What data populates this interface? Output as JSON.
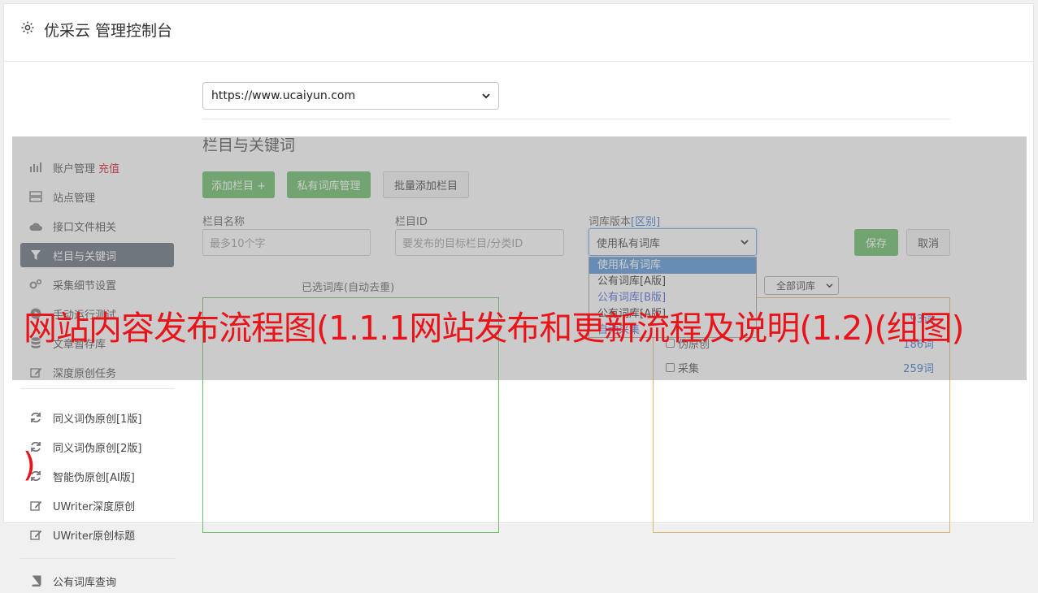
{
  "header": {
    "title": "优采云 管理控制台",
    "icon": "gear-icon"
  },
  "sidebar": {
    "items": [
      {
        "label": "账户管理",
        "badge": "充值",
        "icon": "bar-chart-icon"
      },
      {
        "label": "站点管理",
        "icon": "server-icon"
      },
      {
        "label": "接口文件相关",
        "icon": "cloud-upload-icon"
      },
      {
        "label": "栏目与关键词",
        "icon": "filter-icon",
        "active": true
      },
      {
        "label": "采集细节设置",
        "icon": "cogs-icon"
      },
      {
        "label": "手动运行测试",
        "icon": "play-circle-icon"
      },
      {
        "label": "文章暂存库",
        "icon": "database-icon"
      },
      {
        "label": "深度原创任务",
        "icon": "edit-icon"
      },
      {
        "label": "同义词伪原创[1版]",
        "icon": "refresh-icon"
      },
      {
        "label": "同义词伪原创[2版]",
        "icon": "refresh-icon"
      },
      {
        "label": "智能伪原创[AI版]",
        "icon": "refresh-icon"
      },
      {
        "label": "UWriter深度原创",
        "icon": "edit-icon"
      },
      {
        "label": "UWriter原创标题",
        "icon": "edit-icon"
      },
      {
        "label": "公有词库查询",
        "icon": "book-icon"
      }
    ]
  },
  "main": {
    "site_select": "https://www.ucaiyun.com",
    "section_title": "栏目与关键词",
    "buttons": {
      "add_column": "添加栏目 +",
      "private_lib": "私有词库管理",
      "batch_add": "批量添加栏目",
      "save": "保存",
      "cancel": "取消"
    },
    "fields": {
      "column_name_label": "栏目名称",
      "column_name_placeholder": "最多10个字",
      "column_id_label": "栏目ID",
      "column_id_placeholder": "要发布的目标栏目/分类ID",
      "lib_version_label": "词库版本",
      "lib_version_link": "[区别]",
      "lib_version_value": "使用私有词库"
    },
    "dropdown_options": [
      "使用私有词库",
      "公有词库[A版]",
      "公有词库[B版]",
      "公有词库[A版]",
      "自动采集"
    ],
    "selected_panel_title": "已选词库(自动去重)",
    "lib_filter": "全部词库",
    "lib_rows": [
      {
        "name": "",
        "count": "93词"
      },
      {
        "name": "伪原创",
        "count": "186词"
      },
      {
        "name": "采集",
        "count": "259词"
      }
    ]
  },
  "overlay": {
    "headline": "网站内容发布流程图(1.1.1网站发布和更新流程及说明(1.2)(组图)",
    "headline_tail": ")"
  },
  "colors": {
    "accent_green": "#5cb85c",
    "active_nav": "#5a6472",
    "headline_red": "#e8141a",
    "link_blue": "#2a6dcb"
  }
}
